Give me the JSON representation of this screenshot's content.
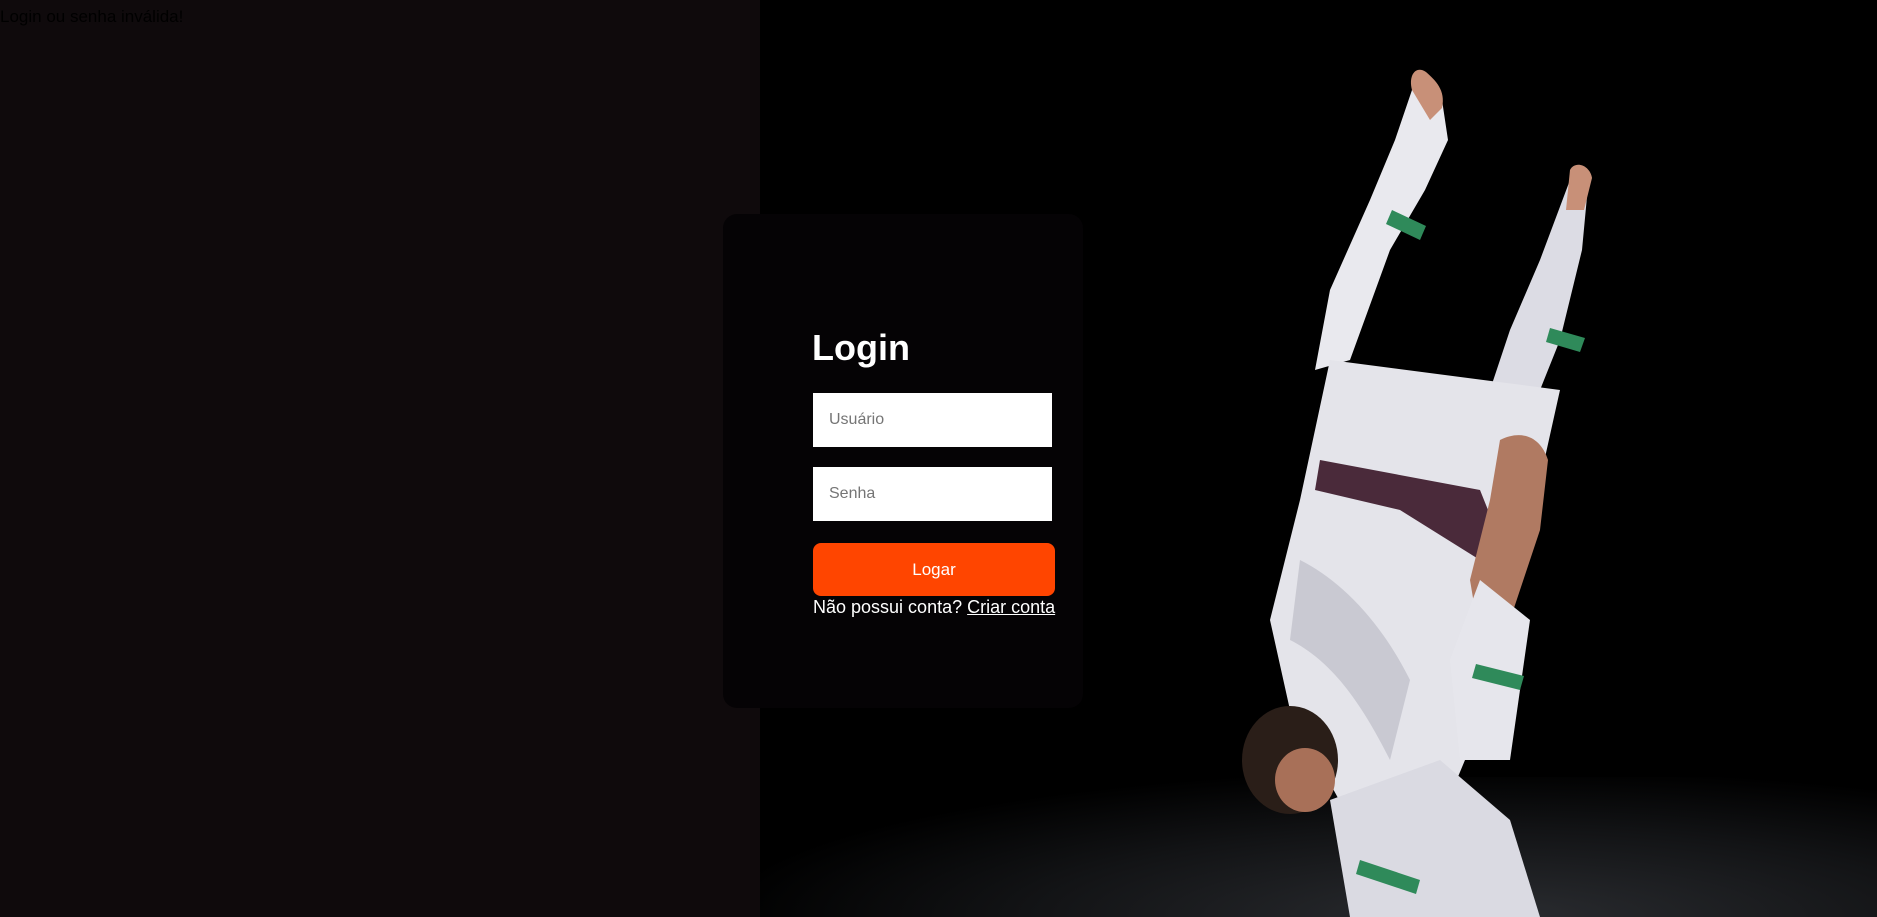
{
  "error": {
    "message": "Login ou senha inválida!"
  },
  "login": {
    "title": "Login",
    "username_placeholder": "Usuário",
    "password_placeholder": "Senha",
    "submit_label": "Logar",
    "signup_prompt": "Não possui conta?",
    "signup_link": "Criar conta"
  },
  "colors": {
    "accent": "#ff4500",
    "left_background": "#0f0a0c",
    "right_background": "#000000"
  },
  "photo": {
    "icon": "jiu-jitsu-athlete-photo"
  }
}
